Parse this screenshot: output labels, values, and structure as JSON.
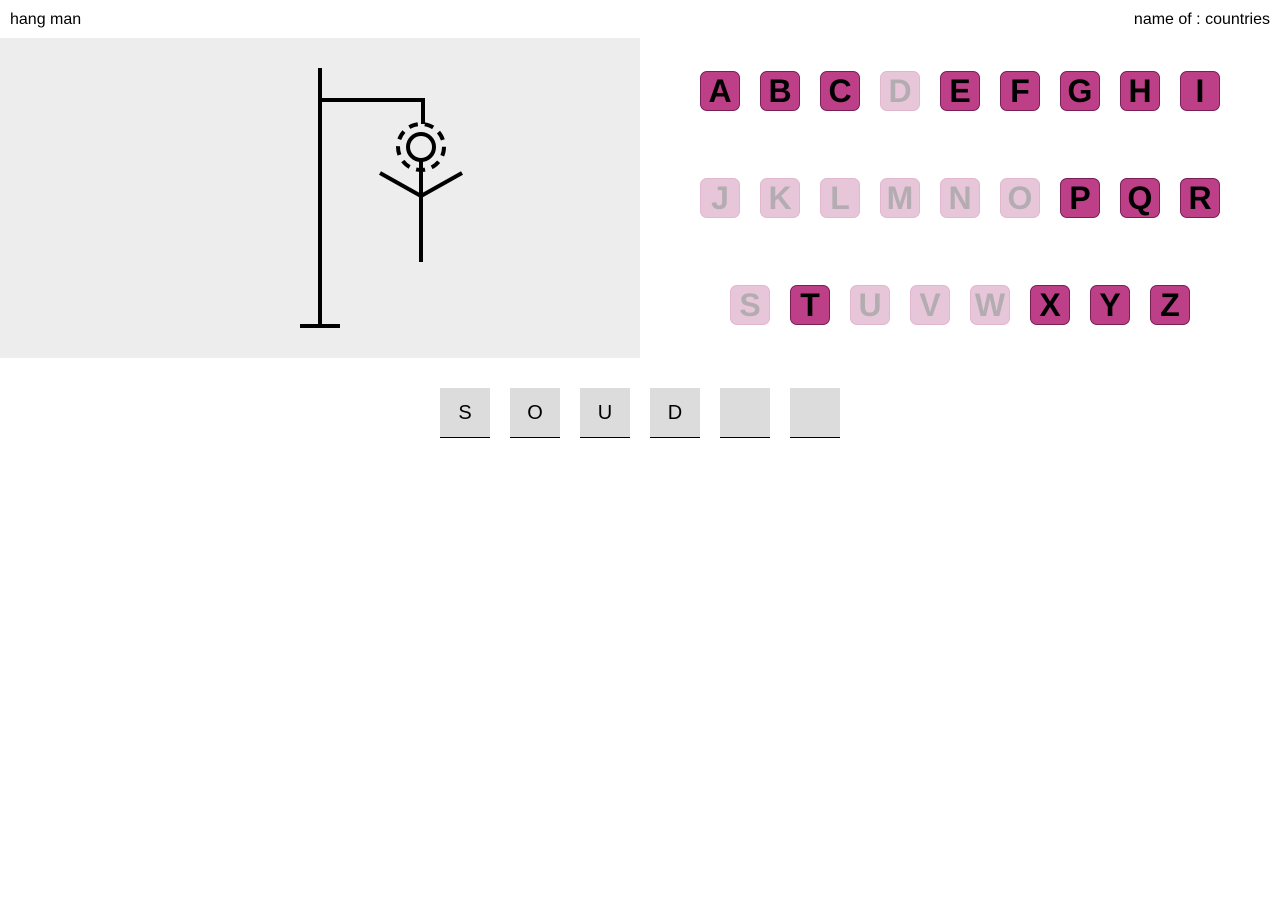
{
  "header": {
    "title": "hang man",
    "category": "name of : countries"
  },
  "theme": {
    "key_active": "#bc3f87",
    "key_used": "#e8c6d9",
    "stage_bg": "#ededed",
    "slot_bg": "#dcdcdc"
  },
  "keyboard": {
    "rows": [
      [
        {
          "letter": "A",
          "used": false
        },
        {
          "letter": "B",
          "used": false
        },
        {
          "letter": "C",
          "used": false
        },
        {
          "letter": "D",
          "used": true
        },
        {
          "letter": "E",
          "used": false
        },
        {
          "letter": "F",
          "used": false
        },
        {
          "letter": "G",
          "used": false
        },
        {
          "letter": "H",
          "used": false
        },
        {
          "letter": "I",
          "used": false
        }
      ],
      [
        {
          "letter": "J",
          "used": true
        },
        {
          "letter": "K",
          "used": true
        },
        {
          "letter": "L",
          "used": true
        },
        {
          "letter": "M",
          "used": true
        },
        {
          "letter": "N",
          "used": true
        },
        {
          "letter": "O",
          "used": true
        },
        {
          "letter": "P",
          "used": false
        },
        {
          "letter": "Q",
          "used": false
        },
        {
          "letter": "R",
          "used": false
        }
      ],
      [
        {
          "letter": "S",
          "used": true
        },
        {
          "letter": "T",
          "used": false
        },
        {
          "letter": "U",
          "used": true
        },
        {
          "letter": "V",
          "used": true
        },
        {
          "letter": "W",
          "used": true
        },
        {
          "letter": "X",
          "used": false
        },
        {
          "letter": "Y",
          "used": false
        },
        {
          "letter": "Z",
          "used": false
        }
      ]
    ]
  },
  "word": {
    "letters": [
      "S",
      "O",
      "U",
      "D",
      "",
      ""
    ]
  },
  "hangman": {
    "parts_shown": [
      "gallows",
      "rope",
      "head",
      "arms",
      "body"
    ]
  }
}
